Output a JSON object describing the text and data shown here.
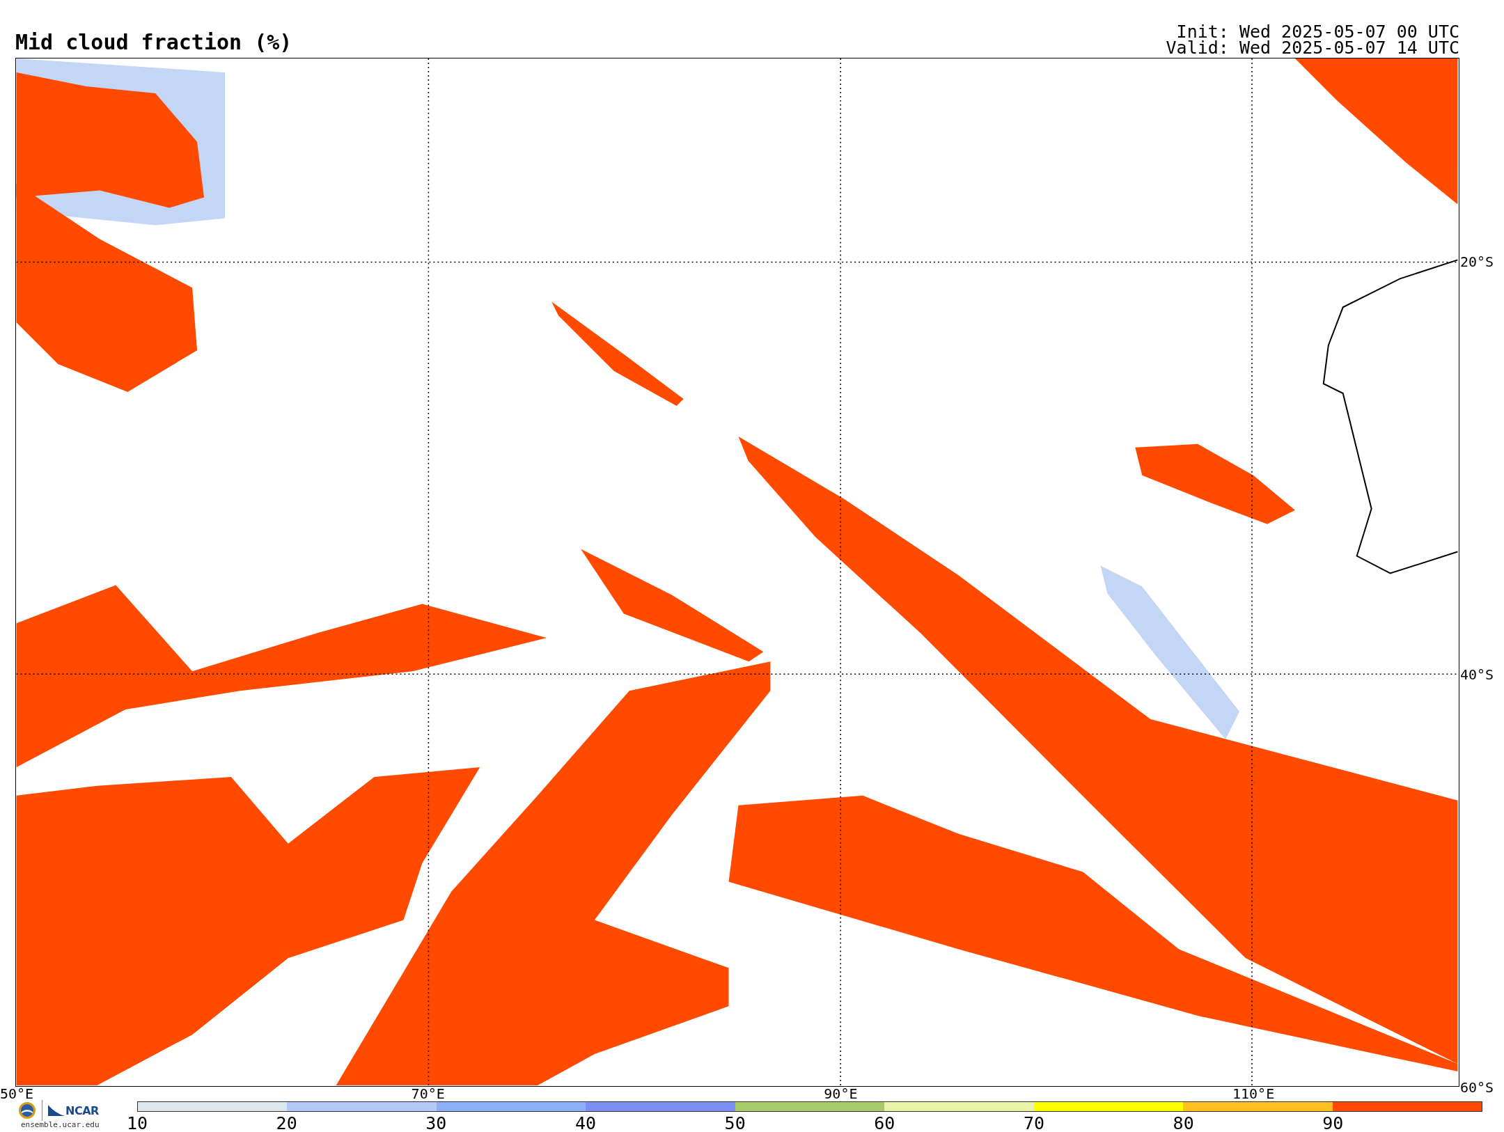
{
  "title": "Mid cloud fraction (%)",
  "init": "Init: Wed 2025-05-07 00 UTC",
  "valid": "Valid: Wed 2025-05-07 14 UTC",
  "map": {
    "lon_labels": [
      "50°E",
      "70°E",
      "90°E",
      "110°E"
    ],
    "lat_labels": [
      "20°S",
      "40°S",
      "60°S"
    ]
  },
  "colorbar": {
    "bins": [
      {
        "color": "#dce6ee"
      },
      {
        "color": "#b4c8f8"
      },
      {
        "color": "#8cb0f8"
      },
      {
        "color": "#7b8ff5"
      },
      {
        "color": "#a6cc6a"
      },
      {
        "color": "#e8f4a8"
      },
      {
        "color": "#ffff00"
      },
      {
        "color": "#ffc020"
      },
      {
        "color": "#ff4a00"
      }
    ],
    "ticks": [
      "10",
      "20",
      "30",
      "40",
      "50",
      "60",
      "70",
      "80",
      "90"
    ]
  },
  "credits": {
    "org": "NCAR",
    "site": "ensemble.ucar.edu"
  }
}
